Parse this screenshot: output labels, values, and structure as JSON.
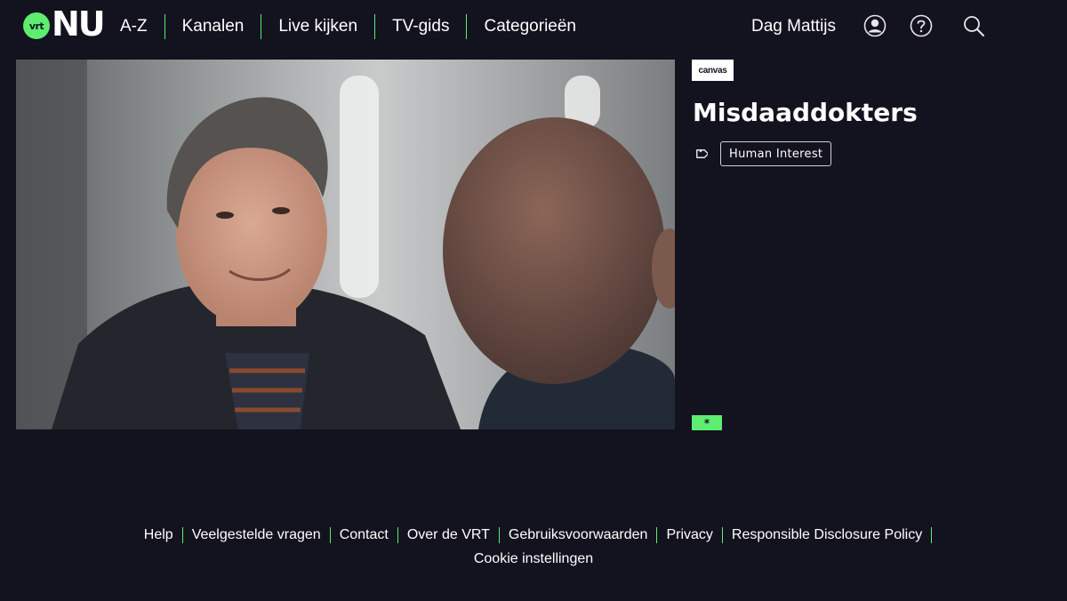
{
  "header": {
    "logo": {
      "badge_text": "vrt",
      "wordmark": "NU"
    },
    "nav": [
      {
        "label": "A-Z"
      },
      {
        "label": "Kanalen"
      },
      {
        "label": "Live kijken"
      },
      {
        "label": "TV-gids"
      },
      {
        "label": "Categorieën"
      }
    ],
    "user_name": "Dag Mattijs",
    "icons": [
      "user-icon",
      "help-icon",
      "search-icon"
    ]
  },
  "program": {
    "channel": "canvas",
    "title": "Misdaaddokters",
    "tag_icon": "tag-icon",
    "category": "Human Interest",
    "badge": "*"
  },
  "footer": {
    "links": [
      {
        "label": "Help"
      },
      {
        "label": "Veelgestelde vragen"
      },
      {
        "label": "Contact"
      },
      {
        "label": "Over de VRT"
      },
      {
        "label": "Gebruiksvoorwaarden"
      },
      {
        "label": "Privacy"
      },
      {
        "label": "Responsible Disclosure Policy"
      }
    ],
    "cookie_label": "Cookie instellingen"
  },
  "colors": {
    "background": "#13121f",
    "accent": "#5ded6f",
    "text": "#ffffff"
  }
}
